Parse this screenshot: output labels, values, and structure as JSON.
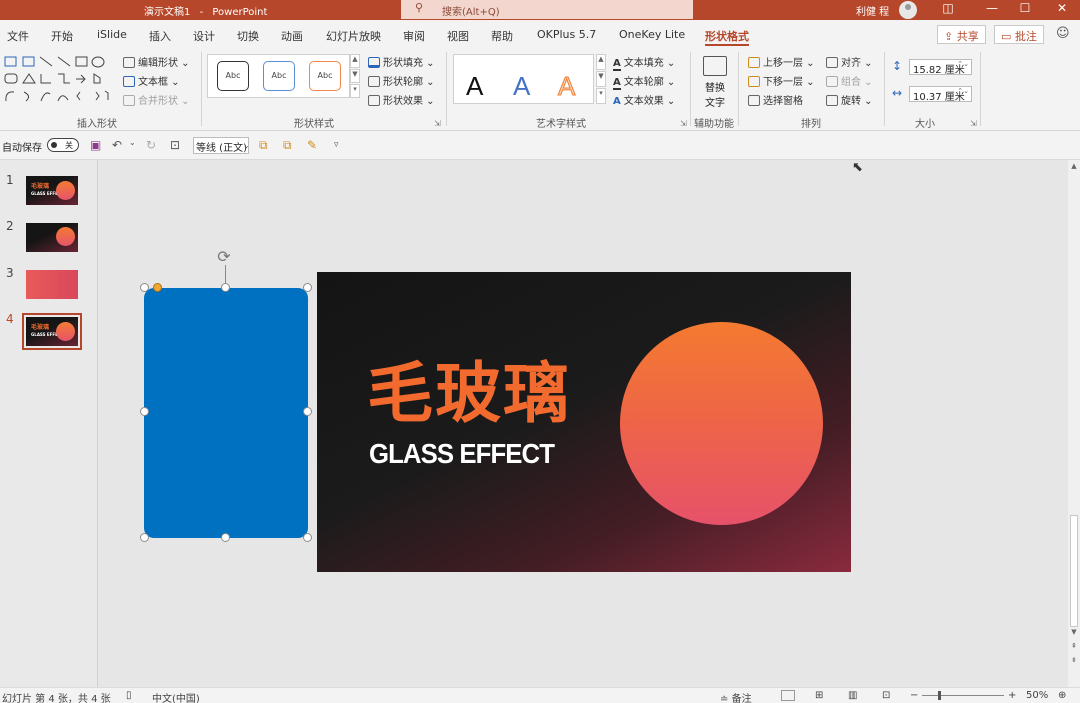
{
  "app": {
    "doc_title": "演示文稿1",
    "app_name": "PowerPoint",
    "title_sep": "-"
  },
  "search": {
    "placeholder": "搜索(Alt+Q)",
    "icon": "search-icon"
  },
  "user": {
    "name": "利健 程"
  },
  "window_buttons": {
    "ribbon_display": "◫",
    "minimize": "—",
    "maximize": "☐",
    "close": "✕"
  },
  "menu": {
    "tabs": [
      {
        "label": "文件"
      },
      {
        "label": "开始"
      },
      {
        "label": "iSlide"
      },
      {
        "label": "插入"
      },
      {
        "label": "设计"
      },
      {
        "label": "切换"
      },
      {
        "label": "动画"
      },
      {
        "label": "幻灯片放映"
      },
      {
        "label": "审阅"
      },
      {
        "label": "视图"
      },
      {
        "label": "帮助"
      },
      {
        "label": "OKPlus 5.7"
      },
      {
        "label": "OneKey Lite"
      },
      {
        "label": "形状格式"
      }
    ],
    "active_tab": "形状格式",
    "share_label": "共享",
    "comment_label": "批注"
  },
  "ribbon": {
    "insert_shapes": {
      "label": "插入形状",
      "edit_shape": "编辑形状",
      "text_box": "文本框",
      "merge_shapes": "合并形状"
    },
    "shape_styles": {
      "label": "形状样式",
      "preview": [
        "Abc",
        "Abc",
        "Abc"
      ],
      "fill": "形状填充",
      "outline": "形状轮廓",
      "effects": "形状效果"
    },
    "wordart": {
      "label": "艺术字样式",
      "letters": [
        "A",
        "A",
        "A"
      ],
      "text_fill": "文本填充",
      "text_outline": "文本轮廓",
      "text_effects": "文本效果"
    },
    "accessibility": {
      "label": "辅助功能",
      "alt_text_line1": "替换",
      "alt_text_line2": "文字"
    },
    "arrange": {
      "label": "排列",
      "bring_forward": "上移一层",
      "send_backward": "下移一层",
      "selection_pane": "选择窗格",
      "align": "对齐",
      "group": "组合",
      "rotate": "旋转"
    },
    "size": {
      "label": "大小",
      "height": "15.82 厘米",
      "width": "10.37 厘米"
    }
  },
  "qat": {
    "autosave_label": "自动保存",
    "autosave_state": "关",
    "font_value": "等线 (正文)"
  },
  "thumbnails": [
    {
      "num": "1",
      "title": "毛玻璃",
      "sub": "GLASS EFFECT"
    },
    {
      "num": "2"
    },
    {
      "num": "3"
    },
    {
      "num": "4",
      "title": "毛玻璃",
      "sub": "GLASS EFFECT"
    }
  ],
  "slide": {
    "title": "毛玻璃",
    "subtitle": "GLASS EFFECT"
  },
  "colors": {
    "accent": "#b7472a",
    "blue_shape": "#0070c0",
    "title_orange": "#f26a2e",
    "circle_top": "#f47a30",
    "circle_bottom": "#e6526a"
  },
  "status": {
    "slide_info": "幻灯片 第 4 张，共 4 张",
    "language": "中文(中国)",
    "notes": "备注",
    "zoom": "50%"
  }
}
